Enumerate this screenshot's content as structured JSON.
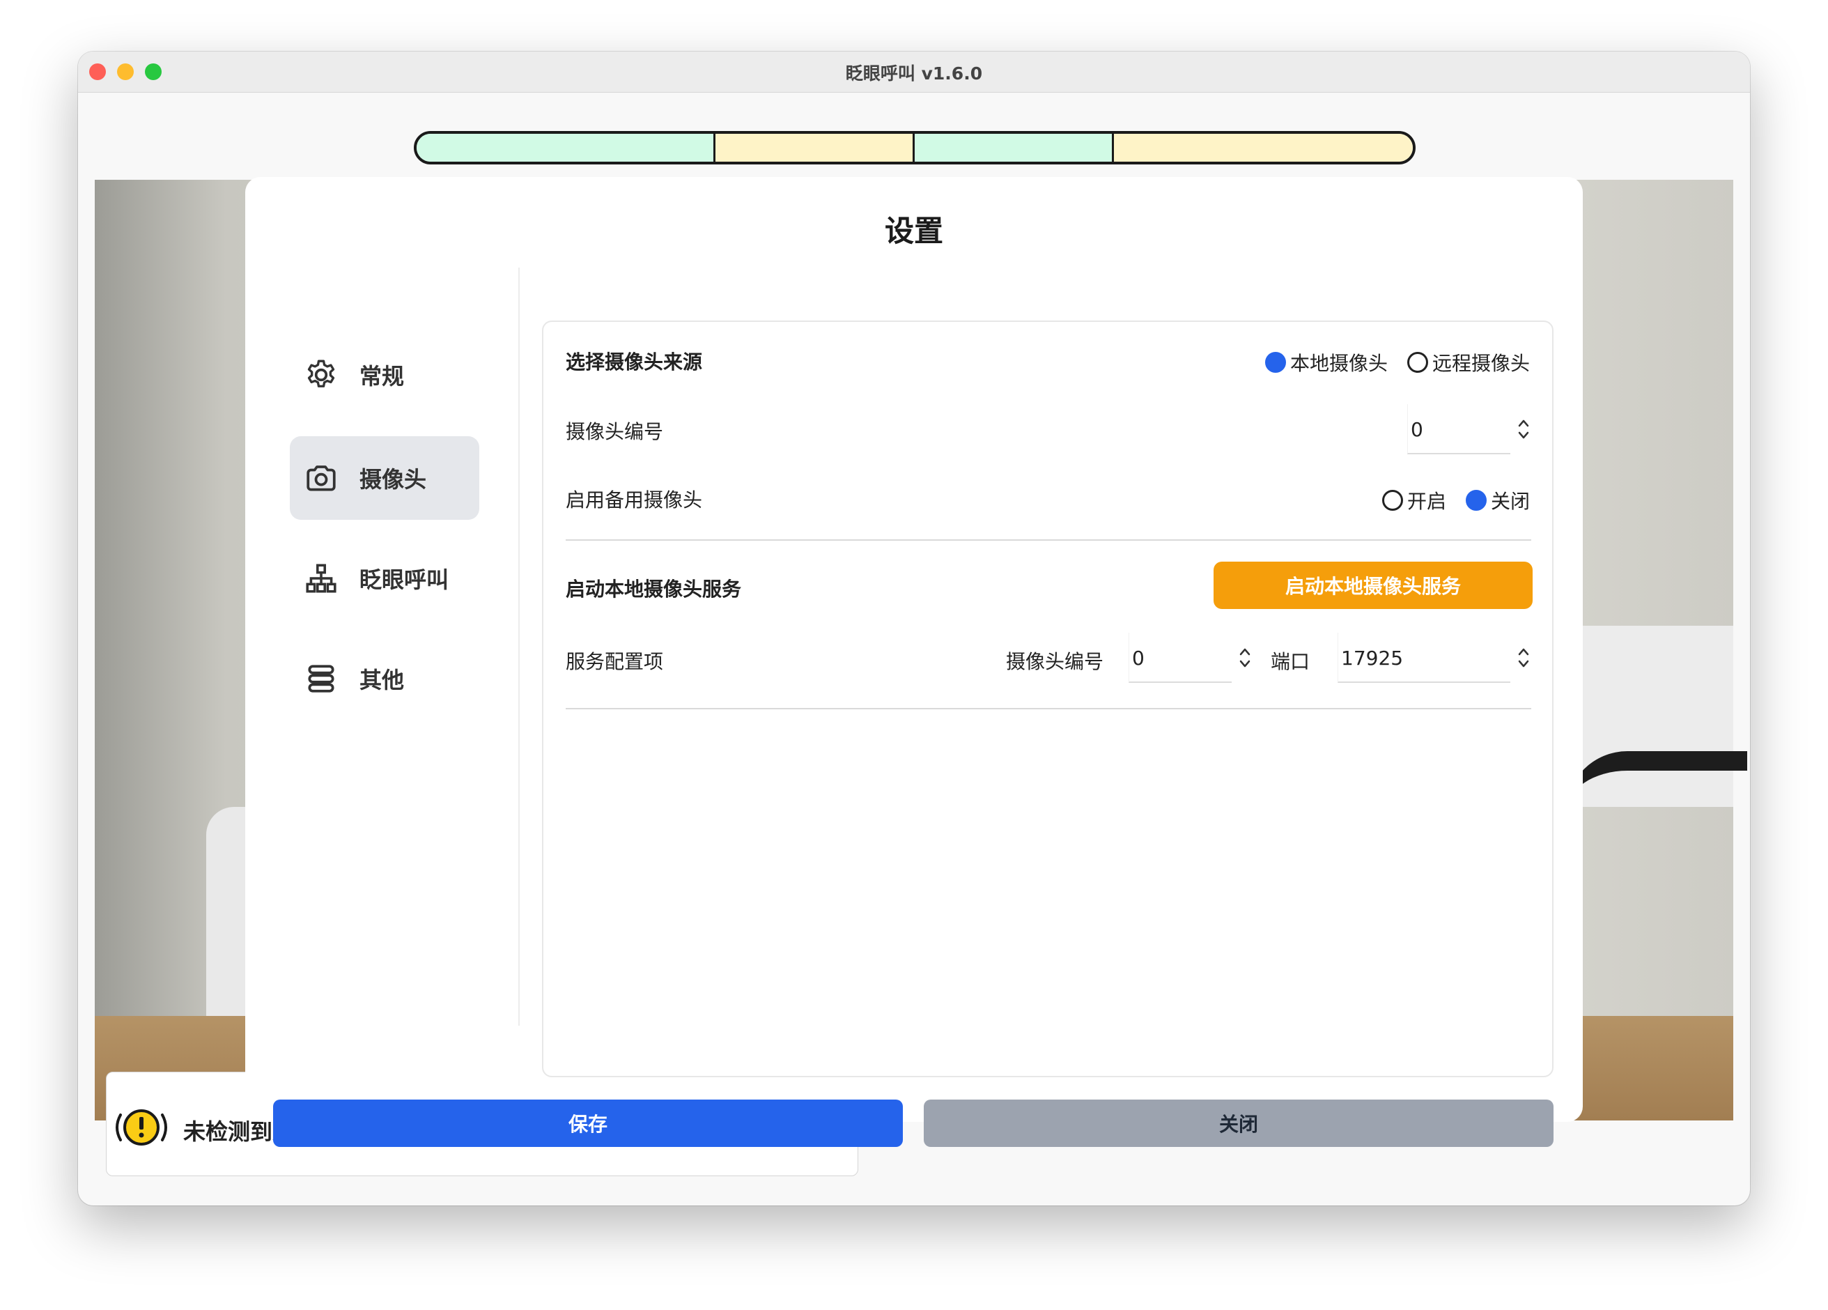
{
  "window": {
    "title": "眨眼呼叫 v1.6.0"
  },
  "progress": [
    {
      "color": "#d1fae5",
      "fraction": 0.3
    },
    {
      "color": "#fef3c7",
      "fraction": 0.2
    },
    {
      "color": "#d1fae5",
      "fraction": 0.2
    },
    {
      "color": "#fef3c7",
      "fraction": 0.3
    }
  ],
  "status": {
    "text": "未检测到人脸",
    "icon": "warning-circle-icon"
  },
  "modal": {
    "title": "设置",
    "nav": [
      {
        "label": "常规",
        "icon": "gear-icon",
        "active": false
      },
      {
        "label": "摄像头",
        "icon": "camera-icon",
        "active": true
      },
      {
        "label": "眨眼呼叫",
        "icon": "hierarchy-icon",
        "active": false
      },
      {
        "label": "其他",
        "icon": "stack-icon",
        "active": false
      }
    ],
    "camera": {
      "source_label": "选择摄像头来源",
      "source_options": [
        {
          "label": "本地摄像头",
          "selected": true
        },
        {
          "label": "远程摄像头",
          "selected": false
        }
      ],
      "index_label": "摄像头编号",
      "index_value": "0",
      "backup_label": "启用备用摄像头",
      "backup_options": [
        {
          "label": "开启",
          "selected": false
        },
        {
          "label": "关闭",
          "selected": true
        }
      ],
      "service_label": "启动本地摄像头服务",
      "service_button": "启动本地摄像头服务",
      "config_label": "服务配置项",
      "config_index_label": "摄像头编号",
      "config_index_value": "0",
      "config_port_label": "端口",
      "config_port_value": "17925"
    },
    "save_button": "保存",
    "close_button": "关闭"
  },
  "colors": {
    "primary": "#2563eb",
    "orange": "#f59e0b",
    "gray": "#9ca3af"
  }
}
